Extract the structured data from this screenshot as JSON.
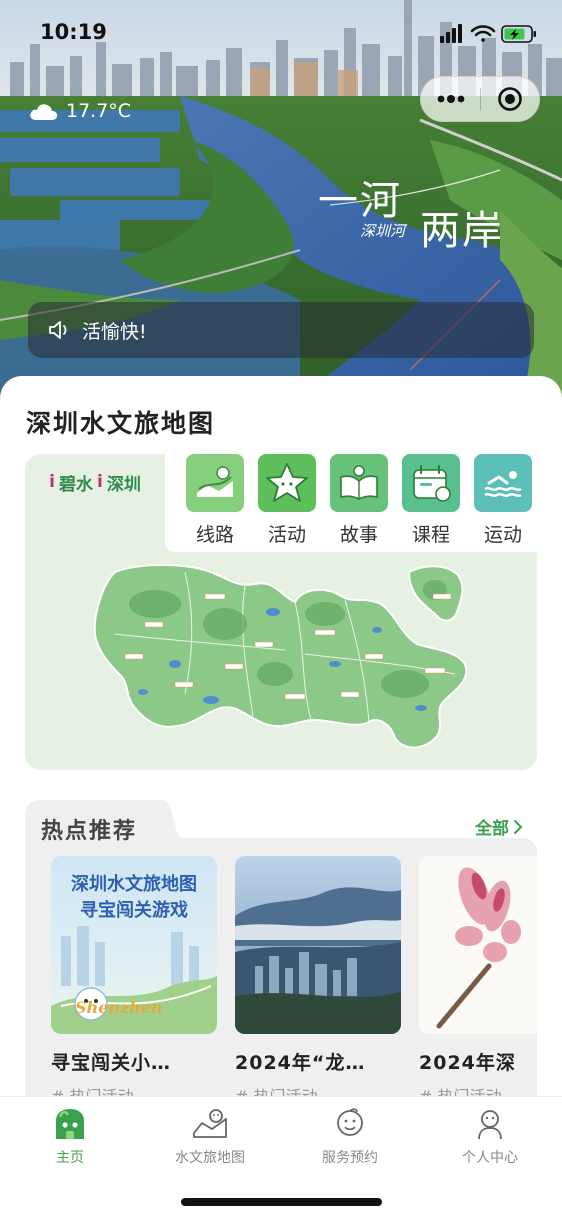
{
  "status_bar": {
    "time": "10:19"
  },
  "hero": {
    "weather_temp": "17.7°C",
    "title_line1": "一河",
    "title_line2": "两岸",
    "title_sub": "深圳河",
    "announcement": "活愉快!"
  },
  "map_section": {
    "title": "深圳水文旅地图",
    "brand_word1": "碧水",
    "brand_word2": "深圳",
    "brand_mark": "i",
    "categories": [
      {
        "label": "线路",
        "icon": "route-icon",
        "color": "#86cf7c"
      },
      {
        "label": "活动",
        "icon": "star-activity-icon",
        "color": "#5cbf5a"
      },
      {
        "label": "故事",
        "icon": "book-story-icon",
        "color": "#67c17a"
      },
      {
        "label": "课程",
        "icon": "calendar-course-icon",
        "color": "#58bf8f"
      },
      {
        "label": "运动",
        "icon": "swimming-icon",
        "color": "#5cbfb8"
      }
    ]
  },
  "hot_section": {
    "title": "热点推荐",
    "all_label": "全部",
    "cards": [
      {
        "title": "寻宝闯关小…",
        "tag": "# 热门活动",
        "poster_line1": "深圳水文旅地图",
        "poster_line2": "寻宝闯关游戏",
        "poster_word": "Shenzhen",
        "image": "poster"
      },
      {
        "title": "2024年“龙…",
        "tag": "# 热门活动",
        "image": "mountain-city"
      },
      {
        "title": "2024年深",
        "tag": "# 热门活动",
        "image": "flower"
      }
    ]
  },
  "tabbar": {
    "tabs": [
      {
        "label": "主页",
        "icon": "home-mascot-icon",
        "active": true
      },
      {
        "label": "水文旅地图",
        "icon": "map-mascot-icon",
        "active": false
      },
      {
        "label": "服务预约",
        "icon": "service-mascot-icon",
        "active": false
      },
      {
        "label": "个人中心",
        "icon": "user-mascot-icon",
        "active": false
      }
    ]
  },
  "colors": {
    "accent_green": "#3aa24c",
    "map_bg": "#e8f2e6",
    "hot_bg": "#efefef"
  }
}
